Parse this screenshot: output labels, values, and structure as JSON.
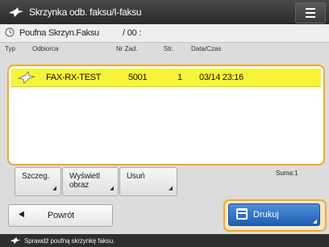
{
  "app": {
    "title": "Skrzynka odb. faksu/I-faksu"
  },
  "box": {
    "name": "Poufna Skrzyn.Faksu",
    "count": "/ 00 :"
  },
  "columns": {
    "type": "Typ",
    "sender": "Odbiorca",
    "job_no": "Nr Zad.",
    "pages": "Str.",
    "datetime": "Data/Czas"
  },
  "rows": [
    {
      "type_icon": "fax-received-icon",
      "sender": "FAX-RX-TEST",
      "job_no": "5001",
      "pages": "1",
      "datetime": "03/14  23:16",
      "selected": true
    }
  ],
  "buttons": {
    "details": "Szczeg.",
    "display_line1": "Wyświetl",
    "display_line2": "obraz",
    "delete": "Usuń",
    "sum_label": "Suma:1",
    "back": "Powrót",
    "print": "Drukuj"
  },
  "status": {
    "message": "Sprawdź poufną skrzynkę faksu."
  },
  "colors": {
    "accent": "#f2a928",
    "selected_row": "#f7f338",
    "print_button": "#2f6fc4",
    "title_bar": "#333333"
  }
}
